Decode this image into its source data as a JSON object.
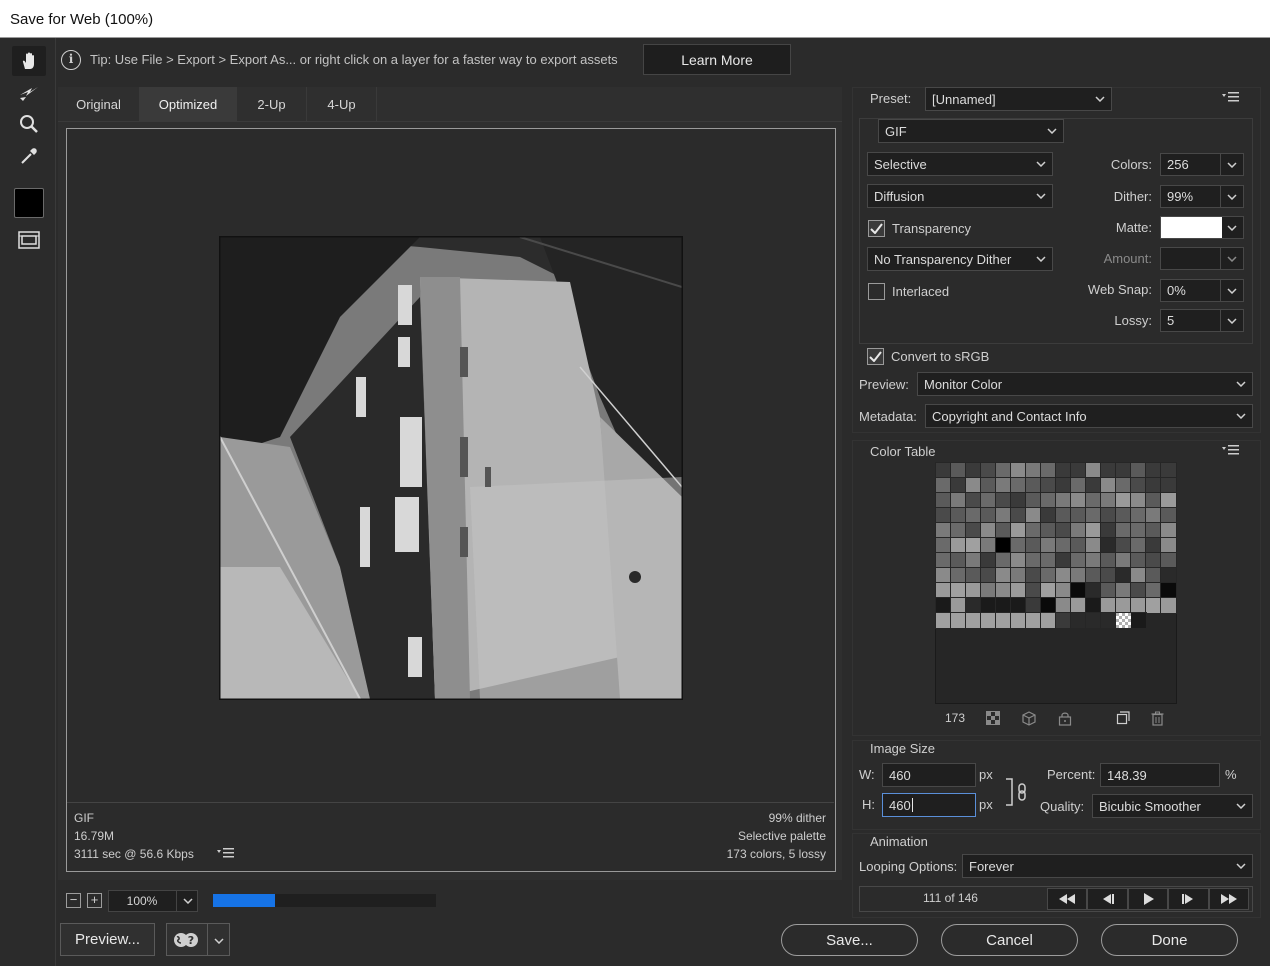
{
  "window": {
    "title": "Save for Web (100%)"
  },
  "tip": {
    "text": "Tip: Use File > Export > Export As...  or right click on a layer for a faster way to export assets",
    "learn_more": "Learn More"
  },
  "tools": [
    "hand-tool",
    "slice-select-tool",
    "zoom-tool",
    "eyedropper-tool",
    "eyedropper-color",
    "toggle-slices-visibility"
  ],
  "tabs": [
    {
      "label": "Original",
      "active": false
    },
    {
      "label": "Optimized",
      "active": true
    },
    {
      "label": "2-Up",
      "active": false
    },
    {
      "label": "4-Up",
      "active": false
    }
  ],
  "canvas_info": {
    "left": [
      "GIF",
      "16.79M",
      "3111 sec @ 56.6 Kbps"
    ],
    "right": [
      "99% dither",
      "Selective palette",
      "173 colors, 5 lossy"
    ]
  },
  "zoom": {
    "value": "100%"
  },
  "progress": 0.28,
  "preset": {
    "label": "Preset:",
    "value": "[Unnamed]",
    "format": "GIF",
    "reduction": "Selective",
    "dither_algo": "Diffusion",
    "transparency_label": "Transparency",
    "transparency_checked": true,
    "transparency_dither": "No Transparency Dither",
    "interlaced_label": "Interlaced",
    "interlaced_checked": false,
    "colors_label": "Colors:",
    "colors": "256",
    "dither_label": "Dither:",
    "dither": "99%",
    "matte_label": "Matte:",
    "matte_color": "#ffffff",
    "amount_label": "Amount:",
    "amount": "",
    "websnap_label": "Web Snap:",
    "websnap": "0%",
    "lossy_label": "Lossy:",
    "lossy": "5"
  },
  "srgb": {
    "label": "Convert to sRGB",
    "checked": true
  },
  "preview": {
    "label": "Preview:",
    "value": "Monitor Color"
  },
  "metadata": {
    "label": "Metadata:",
    "value": "Copyright and Contact Info"
  },
  "color_table": {
    "title": "Color Table",
    "count": "173",
    "grays": [
      "3a",
      "5a",
      "3a",
      "4a",
      "6a",
      "8a",
      "7a",
      "6a",
      "3a",
      "3a",
      "8a",
      "3a",
      "3a",
      "5a",
      "3a",
      "3a",
      "6a",
      "3a",
      "8a",
      "5a",
      "7a",
      "6a",
      "5a",
      "4a",
      "3a",
      "6a",
      "3a",
      "8a",
      "6a",
      "4a",
      "3a",
      "3a",
      "5a",
      "7a",
      "4a",
      "6a",
      "4a",
      "3a",
      "5a",
      "6a",
      "7a",
      "8a",
      "6a",
      "7a",
      "9a",
      "8a",
      "5a",
      "9a",
      "4a",
      "5a",
      "6a",
      "5a",
      "7a",
      "4a",
      "8a",
      "3a",
      "5a",
      "5a",
      "6a",
      "4a",
      "5a",
      "6a",
      "7a",
      "5a",
      "7a",
      "6a",
      "4a",
      "8a",
      "5a",
      "9a",
      "6a",
      "5a",
      "4a",
      "7a",
      "9a",
      "3a",
      "6a",
      "6a",
      "5a",
      "8a",
      "6a",
      "9a",
      "a0",
      "7a",
      "00",
      "6a",
      "5a",
      "7a",
      "6a",
      "5a",
      "8a",
      "2a",
      "4a",
      "6a",
      "3a",
      "8a",
      "6a",
      "5a",
      "7a",
      "3a",
      "6a",
      "8a",
      "6a",
      "6a",
      "3a",
      "6a",
      "7a",
      "5a",
      "7a",
      "5a",
      "4a",
      "5a",
      "8a",
      "6a",
      "5a",
      "4a",
      "8a",
      "7a",
      "4a",
      "6a",
      "8a",
      "7a",
      "5a",
      "4a",
      "2a",
      "8a",
      "5a",
      "2a",
      "9a",
      "a0",
      "9a",
      "7a",
      "8a",
      "9a",
      "4a",
      "a0",
      "8a",
      "0a",
      "2a",
      "5a",
      "7a",
      "4a",
      "6a",
      "0a",
      "1a",
      "9a",
      "2a",
      "1a",
      "1a",
      "1a",
      "3a",
      "0a",
      "8a",
      "9a",
      "1a",
      "9a",
      "9a",
      "9a",
      "a0",
      "9a",
      "a0",
      "a0",
      "a0",
      "a0",
      "a0",
      "a0",
      "a0",
      "a0",
      "3a",
      "2a",
      "2a",
      "2a",
      "1a",
      "1a"
    ]
  },
  "image_size": {
    "title": "Image Size",
    "w_label": "W:",
    "w": "460",
    "h_label": "H:",
    "h": "460",
    "unit": "px",
    "percent_label": "Percent:",
    "percent": "148.39",
    "percent_unit": "%",
    "quality_label": "Quality:",
    "quality": "Bicubic Smoother"
  },
  "animation": {
    "title": "Animation",
    "looping_label": "Looping Options:",
    "looping": "Forever",
    "frame_counter": "111 of 146"
  },
  "footer": {
    "preview": "Preview...",
    "save": "Save...",
    "cancel": "Cancel",
    "done": "Done"
  }
}
